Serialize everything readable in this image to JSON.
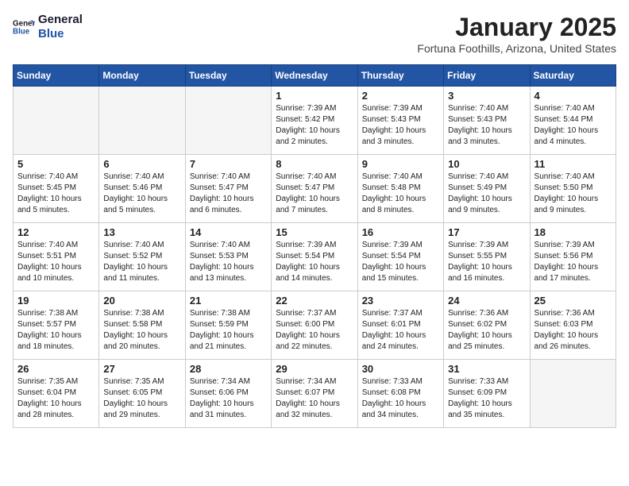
{
  "logo": {
    "line1": "General",
    "line2": "Blue"
  },
  "title": "January 2025",
  "subtitle": "Fortuna Foothills, Arizona, United States",
  "days_of_week": [
    "Sunday",
    "Monday",
    "Tuesday",
    "Wednesday",
    "Thursday",
    "Friday",
    "Saturday"
  ],
  "weeks": [
    [
      {
        "day": "",
        "info": ""
      },
      {
        "day": "",
        "info": ""
      },
      {
        "day": "",
        "info": ""
      },
      {
        "day": "1",
        "info": "Sunrise: 7:39 AM\nSunset: 5:42 PM\nDaylight: 10 hours\nand 2 minutes."
      },
      {
        "day": "2",
        "info": "Sunrise: 7:39 AM\nSunset: 5:43 PM\nDaylight: 10 hours\nand 3 minutes."
      },
      {
        "day": "3",
        "info": "Sunrise: 7:40 AM\nSunset: 5:43 PM\nDaylight: 10 hours\nand 3 minutes."
      },
      {
        "day": "4",
        "info": "Sunrise: 7:40 AM\nSunset: 5:44 PM\nDaylight: 10 hours\nand 4 minutes."
      }
    ],
    [
      {
        "day": "5",
        "info": "Sunrise: 7:40 AM\nSunset: 5:45 PM\nDaylight: 10 hours\nand 5 minutes."
      },
      {
        "day": "6",
        "info": "Sunrise: 7:40 AM\nSunset: 5:46 PM\nDaylight: 10 hours\nand 5 minutes."
      },
      {
        "day": "7",
        "info": "Sunrise: 7:40 AM\nSunset: 5:47 PM\nDaylight: 10 hours\nand 6 minutes."
      },
      {
        "day": "8",
        "info": "Sunrise: 7:40 AM\nSunset: 5:47 PM\nDaylight: 10 hours\nand 7 minutes."
      },
      {
        "day": "9",
        "info": "Sunrise: 7:40 AM\nSunset: 5:48 PM\nDaylight: 10 hours\nand 8 minutes."
      },
      {
        "day": "10",
        "info": "Sunrise: 7:40 AM\nSunset: 5:49 PM\nDaylight: 10 hours\nand 9 minutes."
      },
      {
        "day": "11",
        "info": "Sunrise: 7:40 AM\nSunset: 5:50 PM\nDaylight: 10 hours\nand 9 minutes."
      }
    ],
    [
      {
        "day": "12",
        "info": "Sunrise: 7:40 AM\nSunset: 5:51 PM\nDaylight: 10 hours\nand 10 minutes."
      },
      {
        "day": "13",
        "info": "Sunrise: 7:40 AM\nSunset: 5:52 PM\nDaylight: 10 hours\nand 11 minutes."
      },
      {
        "day": "14",
        "info": "Sunrise: 7:40 AM\nSunset: 5:53 PM\nDaylight: 10 hours\nand 13 minutes."
      },
      {
        "day": "15",
        "info": "Sunrise: 7:39 AM\nSunset: 5:54 PM\nDaylight: 10 hours\nand 14 minutes."
      },
      {
        "day": "16",
        "info": "Sunrise: 7:39 AM\nSunset: 5:54 PM\nDaylight: 10 hours\nand 15 minutes."
      },
      {
        "day": "17",
        "info": "Sunrise: 7:39 AM\nSunset: 5:55 PM\nDaylight: 10 hours\nand 16 minutes."
      },
      {
        "day": "18",
        "info": "Sunrise: 7:39 AM\nSunset: 5:56 PM\nDaylight: 10 hours\nand 17 minutes."
      }
    ],
    [
      {
        "day": "19",
        "info": "Sunrise: 7:38 AM\nSunset: 5:57 PM\nDaylight: 10 hours\nand 18 minutes."
      },
      {
        "day": "20",
        "info": "Sunrise: 7:38 AM\nSunset: 5:58 PM\nDaylight: 10 hours\nand 20 minutes."
      },
      {
        "day": "21",
        "info": "Sunrise: 7:38 AM\nSunset: 5:59 PM\nDaylight: 10 hours\nand 21 minutes."
      },
      {
        "day": "22",
        "info": "Sunrise: 7:37 AM\nSunset: 6:00 PM\nDaylight: 10 hours\nand 22 minutes."
      },
      {
        "day": "23",
        "info": "Sunrise: 7:37 AM\nSunset: 6:01 PM\nDaylight: 10 hours\nand 24 minutes."
      },
      {
        "day": "24",
        "info": "Sunrise: 7:36 AM\nSunset: 6:02 PM\nDaylight: 10 hours\nand 25 minutes."
      },
      {
        "day": "25",
        "info": "Sunrise: 7:36 AM\nSunset: 6:03 PM\nDaylight: 10 hours\nand 26 minutes."
      }
    ],
    [
      {
        "day": "26",
        "info": "Sunrise: 7:35 AM\nSunset: 6:04 PM\nDaylight: 10 hours\nand 28 minutes."
      },
      {
        "day": "27",
        "info": "Sunrise: 7:35 AM\nSunset: 6:05 PM\nDaylight: 10 hours\nand 29 minutes."
      },
      {
        "day": "28",
        "info": "Sunrise: 7:34 AM\nSunset: 6:06 PM\nDaylight: 10 hours\nand 31 minutes."
      },
      {
        "day": "29",
        "info": "Sunrise: 7:34 AM\nSunset: 6:07 PM\nDaylight: 10 hours\nand 32 minutes."
      },
      {
        "day": "30",
        "info": "Sunrise: 7:33 AM\nSunset: 6:08 PM\nDaylight: 10 hours\nand 34 minutes."
      },
      {
        "day": "31",
        "info": "Sunrise: 7:33 AM\nSunset: 6:09 PM\nDaylight: 10 hours\nand 35 minutes."
      },
      {
        "day": "",
        "info": ""
      }
    ]
  ]
}
